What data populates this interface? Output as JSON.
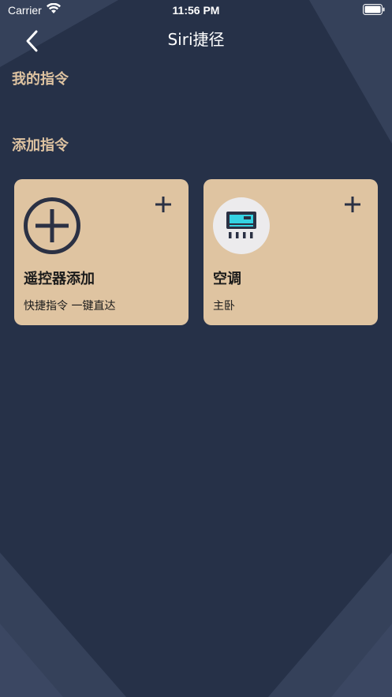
{
  "status_bar": {
    "carrier": "Carrier",
    "time": "11:56 PM"
  },
  "nav": {
    "title": "Siri捷径",
    "back_icon": "chevron-left-icon"
  },
  "sections": {
    "mine_title": "我的指令",
    "add_title": "添加指令"
  },
  "cards": [
    {
      "title": "遥控器添加",
      "subtitle": "快捷指令 一键直达",
      "icon": "plus-circle-icon",
      "action_icon": "plus-icon"
    },
    {
      "title": "空调",
      "subtitle": "主卧",
      "icon": "air-conditioner-icon",
      "action_icon": "plus-icon"
    }
  ],
  "colors": {
    "background": "#263148",
    "accent": "#dec3a1",
    "card": "#dfc4a1",
    "icon_dark": "#2b3144",
    "ac_screen": "#35d3e3"
  }
}
